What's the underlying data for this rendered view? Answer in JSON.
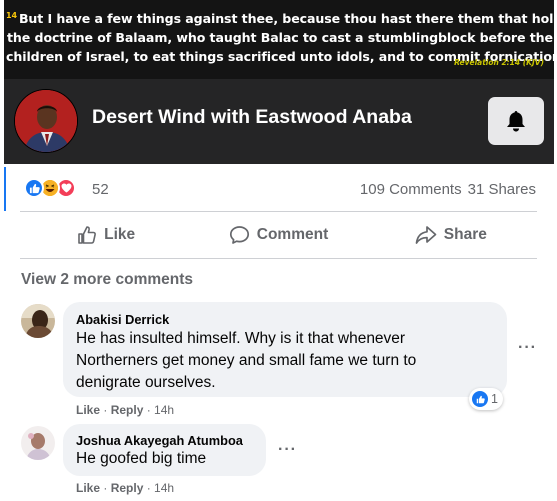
{
  "post": {
    "banner": {
      "verse_num": "14",
      "line1": "But I have a few things against thee, because thou hast there them that hold",
      "line2": "the doctrine of Balaam, who taught Balac to cast a stumblingblock before the",
      "line3": "children of Israel, to eat things sacrificed unto idols, and to commit fornication.",
      "reference": "Revelation 2:14 (KJV)"
    },
    "page_name": "Desert Wind with Eastwood Anaba",
    "reactions_count": "52",
    "comments_count": "109 Comments",
    "shares_count": "31 Shares"
  },
  "actions": {
    "like": "Like",
    "comment": "Comment",
    "share": "Share"
  },
  "view_more": "View 2 more comments",
  "comments": [
    {
      "author": "Abakisi Derrick",
      "line1": "He has insulted himself. Why is it that whenever",
      "line2": "Northerners get money and small fame we turn to",
      "line3": "denigrate ourselves.",
      "like": "Like",
      "reply": "Reply",
      "time": "14h",
      "reaction_count": "1"
    },
    {
      "author": "Joshua Akayegah Atumboa",
      "line1": "He goofed big time",
      "like": "Like",
      "reply": "Reply",
      "time": "14h"
    }
  ],
  "colors": {
    "brand_blue": "#1877f2",
    "love_red": "#f33e58",
    "haha_yellow": "#f7b125",
    "secondary_text": "#65676b"
  }
}
